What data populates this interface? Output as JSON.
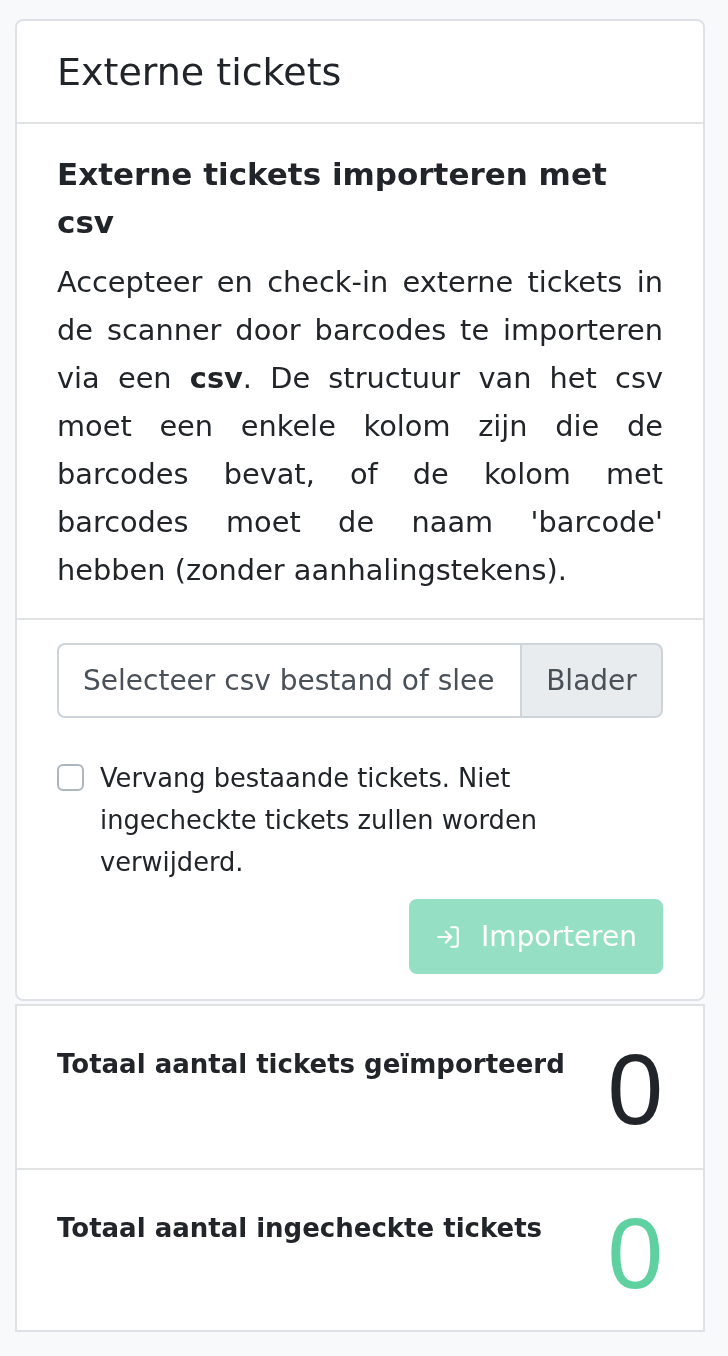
{
  "card": {
    "title": "Externe tickets"
  },
  "import_section": {
    "title": "Externe tickets importeren met csv",
    "description": "Accepteer en check-in externe tickets in de scanner door barcodes te importeren via een **csv**. De structuur van het csv moet een enkele kolom zijn die de barcodes bevat, of de kolom met barcodes moet de naam 'barcode' hebben (zonder aanhalingstekens)."
  },
  "file_input": {
    "placeholder": "Selecteer csv bestand of slee",
    "browse_label": "Blader"
  },
  "replace_checkbox": {
    "label": "Vervang bestaande tickets. Niet ingecheckte tickets zullen worden verwijderd.",
    "checked": false
  },
  "import_button": {
    "label": "Importeren",
    "disabled": true
  },
  "stats": [
    {
      "label": "Totaal aantal tickets geïmporteerd",
      "value": "0",
      "color": "#212529"
    },
    {
      "label": "Totaal aantal ingecheckte tickets",
      "value": "0",
      "color": "#5fd0a0"
    }
  ]
}
